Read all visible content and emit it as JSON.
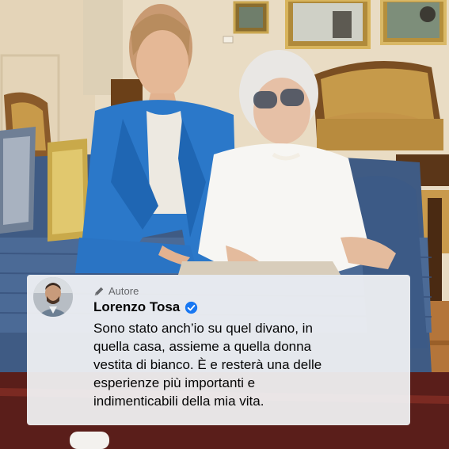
{
  "post": {
    "photo_subject": "photo",
    "comment": {
      "role_badge": "Autore",
      "author_name": "Lorenzo Tosa",
      "verified_icon": "verified-badge-icon",
      "badge_icon": "pencil-icon",
      "lines": [
        "Sono stato anch’io su quel divano, in",
        "quella casa, assieme a quella donna",
        "vestita di bianco. È e resterà una delle",
        "esperienze più importanti e",
        "indimenticabili della mia vita."
      ]
    }
  },
  "colors": {
    "accent_blue": "#1877f2",
    "card_bg": "#f2f3f5",
    "text_primary": "#050505",
    "text_secondary": "#65676b"
  }
}
